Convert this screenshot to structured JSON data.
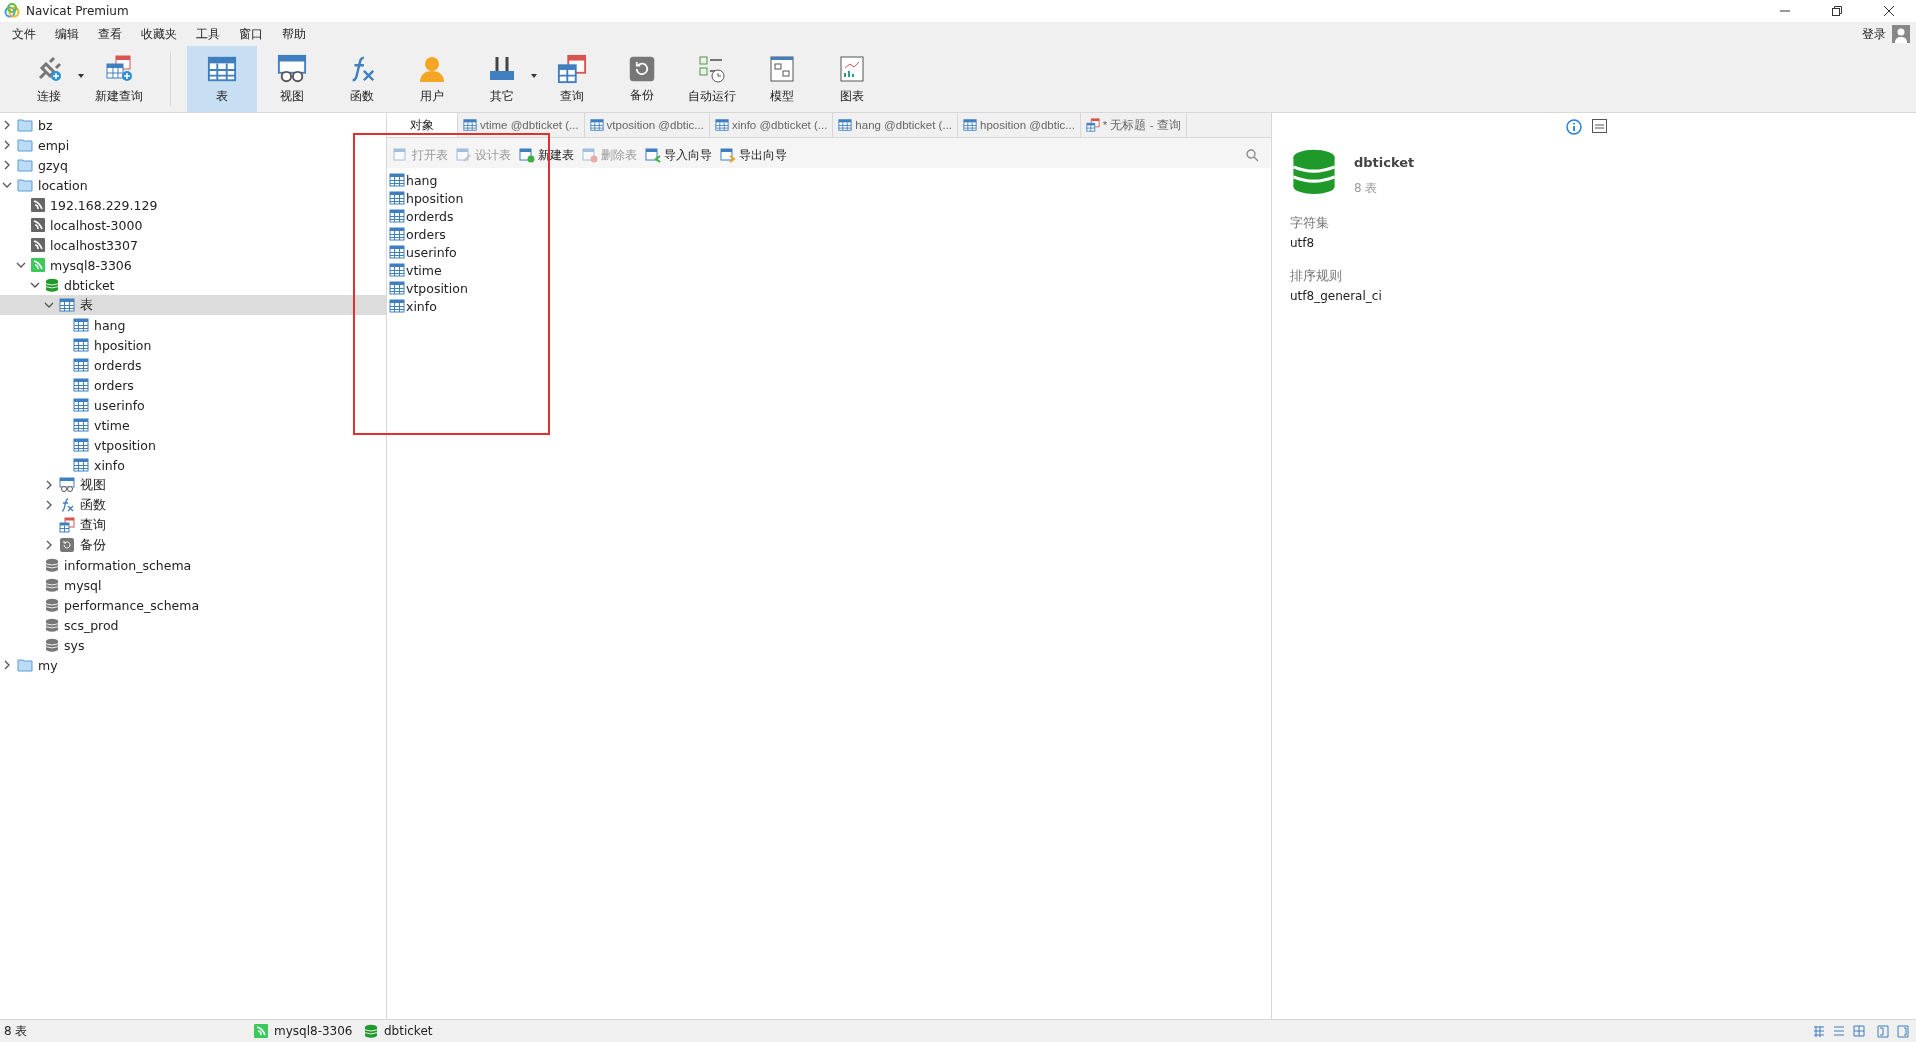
{
  "window": {
    "title": "Navicat Premium"
  },
  "menu": [
    "文件",
    "编辑",
    "查看",
    "收藏夹",
    "工具",
    "窗口",
    "帮助"
  ],
  "login": "登录",
  "toolbar": [
    {
      "label": "连接",
      "kind": "connect",
      "selected": false,
      "dropdown": true
    },
    {
      "label": "新建查询",
      "kind": "newquery",
      "selected": false,
      "dropdown": false
    },
    {
      "label": "表",
      "kind": "table",
      "selected": true,
      "dropdown": false
    },
    {
      "label": "视图",
      "kind": "view",
      "selected": false,
      "dropdown": false
    },
    {
      "label": "函数",
      "kind": "function",
      "selected": false,
      "dropdown": false
    },
    {
      "label": "用户",
      "kind": "user",
      "selected": false,
      "dropdown": false
    },
    {
      "label": "其它",
      "kind": "other",
      "selected": false,
      "dropdown": true
    },
    {
      "label": "查询",
      "kind": "query",
      "selected": false,
      "dropdown": false
    },
    {
      "label": "备份",
      "kind": "backup",
      "selected": false,
      "dropdown": false
    },
    {
      "label": "自动运行",
      "kind": "schedule",
      "selected": false,
      "dropdown": false
    },
    {
      "label": "模型",
      "kind": "model",
      "selected": false,
      "dropdown": false
    },
    {
      "label": "图表",
      "kind": "chart",
      "selected": false,
      "dropdown": false
    }
  ],
  "tree": [
    {
      "label": "bz",
      "kind": "folder",
      "expanded": false,
      "selected": false
    },
    {
      "label": "empi",
      "kind": "folder",
      "expanded": false,
      "selected": false
    },
    {
      "label": "gzyq",
      "kind": "folder",
      "expanded": false,
      "selected": false
    },
    {
      "label": "location",
      "kind": "folder",
      "expanded": true,
      "selected": false,
      "children": [
        {
          "label": "192.168.229.129",
          "kind": "connection",
          "selected": false
        },
        {
          "label": "localhost-3000",
          "kind": "connection",
          "selected": false
        },
        {
          "label": "localhost3307",
          "kind": "connection",
          "selected": false
        },
        {
          "label": "mysql8-3306",
          "kind": "connection-open",
          "expanded": true,
          "selected": false,
          "children": [
            {
              "label": "dbticket",
              "kind": "database-open",
              "expanded": true,
              "selected": false,
              "children": [
                {
                  "label": "表",
                  "kind": "table",
                  "expanded": true,
                  "selected": true,
                  "children": [
                    {
                      "label": "hang",
                      "kind": "table",
                      "selected": false
                    },
                    {
                      "label": "hposition",
                      "kind": "table",
                      "selected": false
                    },
                    {
                      "label": "orderds",
                      "kind": "table",
                      "selected": false
                    },
                    {
                      "label": "orders",
                      "kind": "table",
                      "selected": false
                    },
                    {
                      "label": "userinfo",
                      "kind": "table",
                      "selected": false
                    },
                    {
                      "label": "vtime",
                      "kind": "table",
                      "selected": false
                    },
                    {
                      "label": "vtposition",
                      "kind": "table",
                      "selected": false
                    },
                    {
                      "label": "xinfo",
                      "kind": "table",
                      "selected": false
                    }
                  ]
                },
                {
                  "label": "视图",
                  "kind": "view",
                  "expanded": false,
                  "selected": false
                },
                {
                  "label": "函数",
                  "kind": "function",
                  "expanded": false,
                  "selected": false
                },
                {
                  "label": "查询",
                  "kind": "query",
                  "selected": false
                },
                {
                  "label": "备份",
                  "kind": "backup",
                  "expanded": false,
                  "selected": false
                }
              ]
            },
            {
              "label": "information_schema",
              "kind": "database",
              "selected": false
            },
            {
              "label": "mysql",
              "kind": "database",
              "selected": false
            },
            {
              "label": "performance_schema",
              "kind": "database",
              "selected": false
            },
            {
              "label": "scs_prod",
              "kind": "database",
              "selected": false
            },
            {
              "label": "sys",
              "kind": "database",
              "selected": false
            }
          ]
        }
      ]
    },
    {
      "label": "my",
      "kind": "folder",
      "expanded": false,
      "selected": false
    }
  ],
  "tabs": [
    {
      "label": "对象",
      "kind": "object",
      "selected": true
    },
    {
      "label": "vtime @dbticket (...",
      "kind": "table",
      "selected": false
    },
    {
      "label": "vtposition @dbtic...",
      "kind": "table",
      "selected": false
    },
    {
      "label": "xinfo @dbticket (...",
      "kind": "table",
      "selected": false
    },
    {
      "label": "hang @dbticket (...",
      "kind": "table",
      "selected": false
    },
    {
      "label": "hposition @dbtic...",
      "kind": "table",
      "selected": false
    },
    {
      "label": "* 无标题 - 查询",
      "kind": "query",
      "selected": false
    }
  ],
  "object_actions": [
    {
      "label": "打开表",
      "kind": "open",
      "disabled": true
    },
    {
      "label": "设计表",
      "kind": "design",
      "disabled": true
    },
    {
      "label": "新建表",
      "kind": "new",
      "disabled": false
    },
    {
      "label": "删除表",
      "kind": "delete",
      "disabled": true
    },
    {
      "label": "导入向导",
      "kind": "import",
      "disabled": false
    },
    {
      "label": "导出向导",
      "kind": "export",
      "disabled": false
    }
  ],
  "objects": [
    "hang",
    "hposition",
    "orderds",
    "orders",
    "userinfo",
    "vtime",
    "vtposition",
    "xinfo"
  ],
  "info": {
    "name": "dbticket",
    "subtitle": "8 表",
    "fields": [
      {
        "label": "字符集",
        "value": "utf8"
      },
      {
        "label": "排序规则",
        "value": "utf8_general_ci"
      }
    ]
  },
  "status_bar": {
    "count": "8 表",
    "connection": "mysql8-3306",
    "database": "dbticket"
  }
}
